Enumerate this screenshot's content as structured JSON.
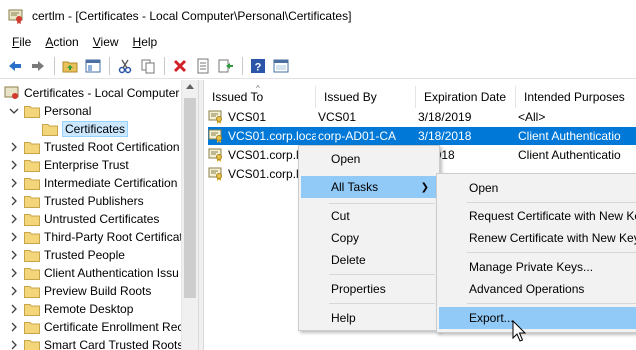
{
  "window": {
    "title": "certlm - [Certificates - Local Computer\\Personal\\Certificates]"
  },
  "menubar": [
    {
      "label": "File",
      "key": "F",
      "rest": "ile"
    },
    {
      "label": "Action",
      "key": "A",
      "rest": "ction"
    },
    {
      "label": "View",
      "key": "V",
      "rest": "iew"
    },
    {
      "label": "Help",
      "key": "H",
      "rest": "elp"
    }
  ],
  "toolbar": {
    "icons": [
      "back-arrow-icon",
      "forward-arrow-icon",
      "up-folder-icon",
      "show-hide-tree-icon",
      "cut-icon",
      "copy-icon",
      "delete-icon",
      "properties-icon",
      "export-list-icon",
      "help-icon",
      "console-icon"
    ]
  },
  "tree": {
    "root": "Certificates - Local Computer",
    "personal": "Personal",
    "certificates": "Certificates",
    "items": [
      "Trusted Root Certification",
      "Enterprise Trust",
      "Intermediate Certification",
      "Trusted Publishers",
      "Untrusted Certificates",
      "Third-Party Root Certificat",
      "Trusted People",
      "Client Authentication Issu",
      "Preview Build Roots",
      "Remote Desktop",
      "Certificate Enrollment Rec",
      "Smart Card Trusted Roots"
    ]
  },
  "list": {
    "columns": [
      "Issued To",
      "Issued By",
      "Expiration Date",
      "Intended Purposes"
    ],
    "rows": [
      {
        "issued_to": "VCS01",
        "issued_by": "VCS01",
        "expiration": "3/18/2019",
        "purposes": "<All>"
      },
      {
        "issued_to": "VCS01.corp.local",
        "issued_by": "corp-AD01-CA",
        "expiration": "3/18/2018",
        "purposes": "Client Authenticatio"
      },
      {
        "issued_to": "VCS01.corp.lo",
        "issued_by": "",
        "expiration": "8/2018",
        "purposes": "Client Authenticatio"
      },
      {
        "issued_to": "VCS01.corp.lo",
        "issued_by": "",
        "expiration": "",
        "purposes": ""
      }
    ]
  },
  "context_menu": {
    "items": [
      "Open",
      "All Tasks",
      "Cut",
      "Copy",
      "Delete",
      "Properties",
      "Help"
    ]
  },
  "submenu": {
    "items": [
      "Open",
      "Request Certificate with New Ke",
      "Renew Certificate with New Key",
      "Manage Private Keys...",
      "Advanced Operations",
      "Export..."
    ]
  }
}
